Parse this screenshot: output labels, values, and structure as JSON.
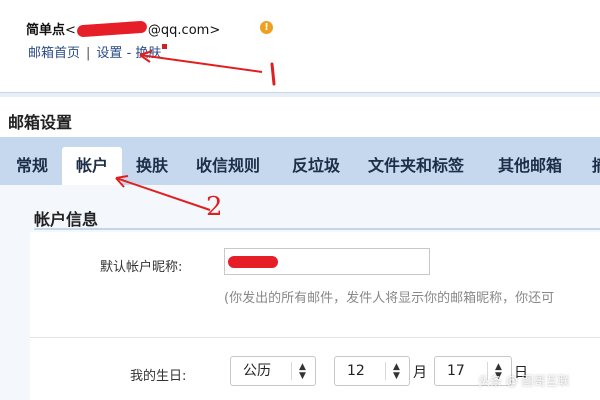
{
  "header": {
    "user_name": "简单点",
    "email_open": "<",
    "email_suffix": "@qq.com>",
    "links": {
      "home": "邮箱首页",
      "settings": "设置",
      "dash": "-",
      "skin": "换肤"
    }
  },
  "settings": {
    "title": "邮箱设置"
  },
  "tabs": [
    "常规",
    "帐户",
    "换肤",
    "收信规则",
    "反垃圾",
    "文件夹和标签",
    "其他邮箱",
    "摘"
  ],
  "account": {
    "section_title": "帐户信息",
    "nickname_label": "默认帐户昵称:",
    "nickname_hint": "(你发出的所有邮件，发件人将显示你的邮箱昵称，你还可",
    "birthday_label": "我的生日:",
    "calendar_value": "公历",
    "month_value": "12",
    "month_unit": "月",
    "day_value": "17",
    "day_unit": "日"
  },
  "annotations": {
    "one": "1",
    "two": "2"
  },
  "watermark": "头条 @ 图哥互联",
  "colors": {
    "accent_blue": "#c5d8ee",
    "link_blue": "#2a4c86",
    "annotation_red": "#e02020"
  }
}
